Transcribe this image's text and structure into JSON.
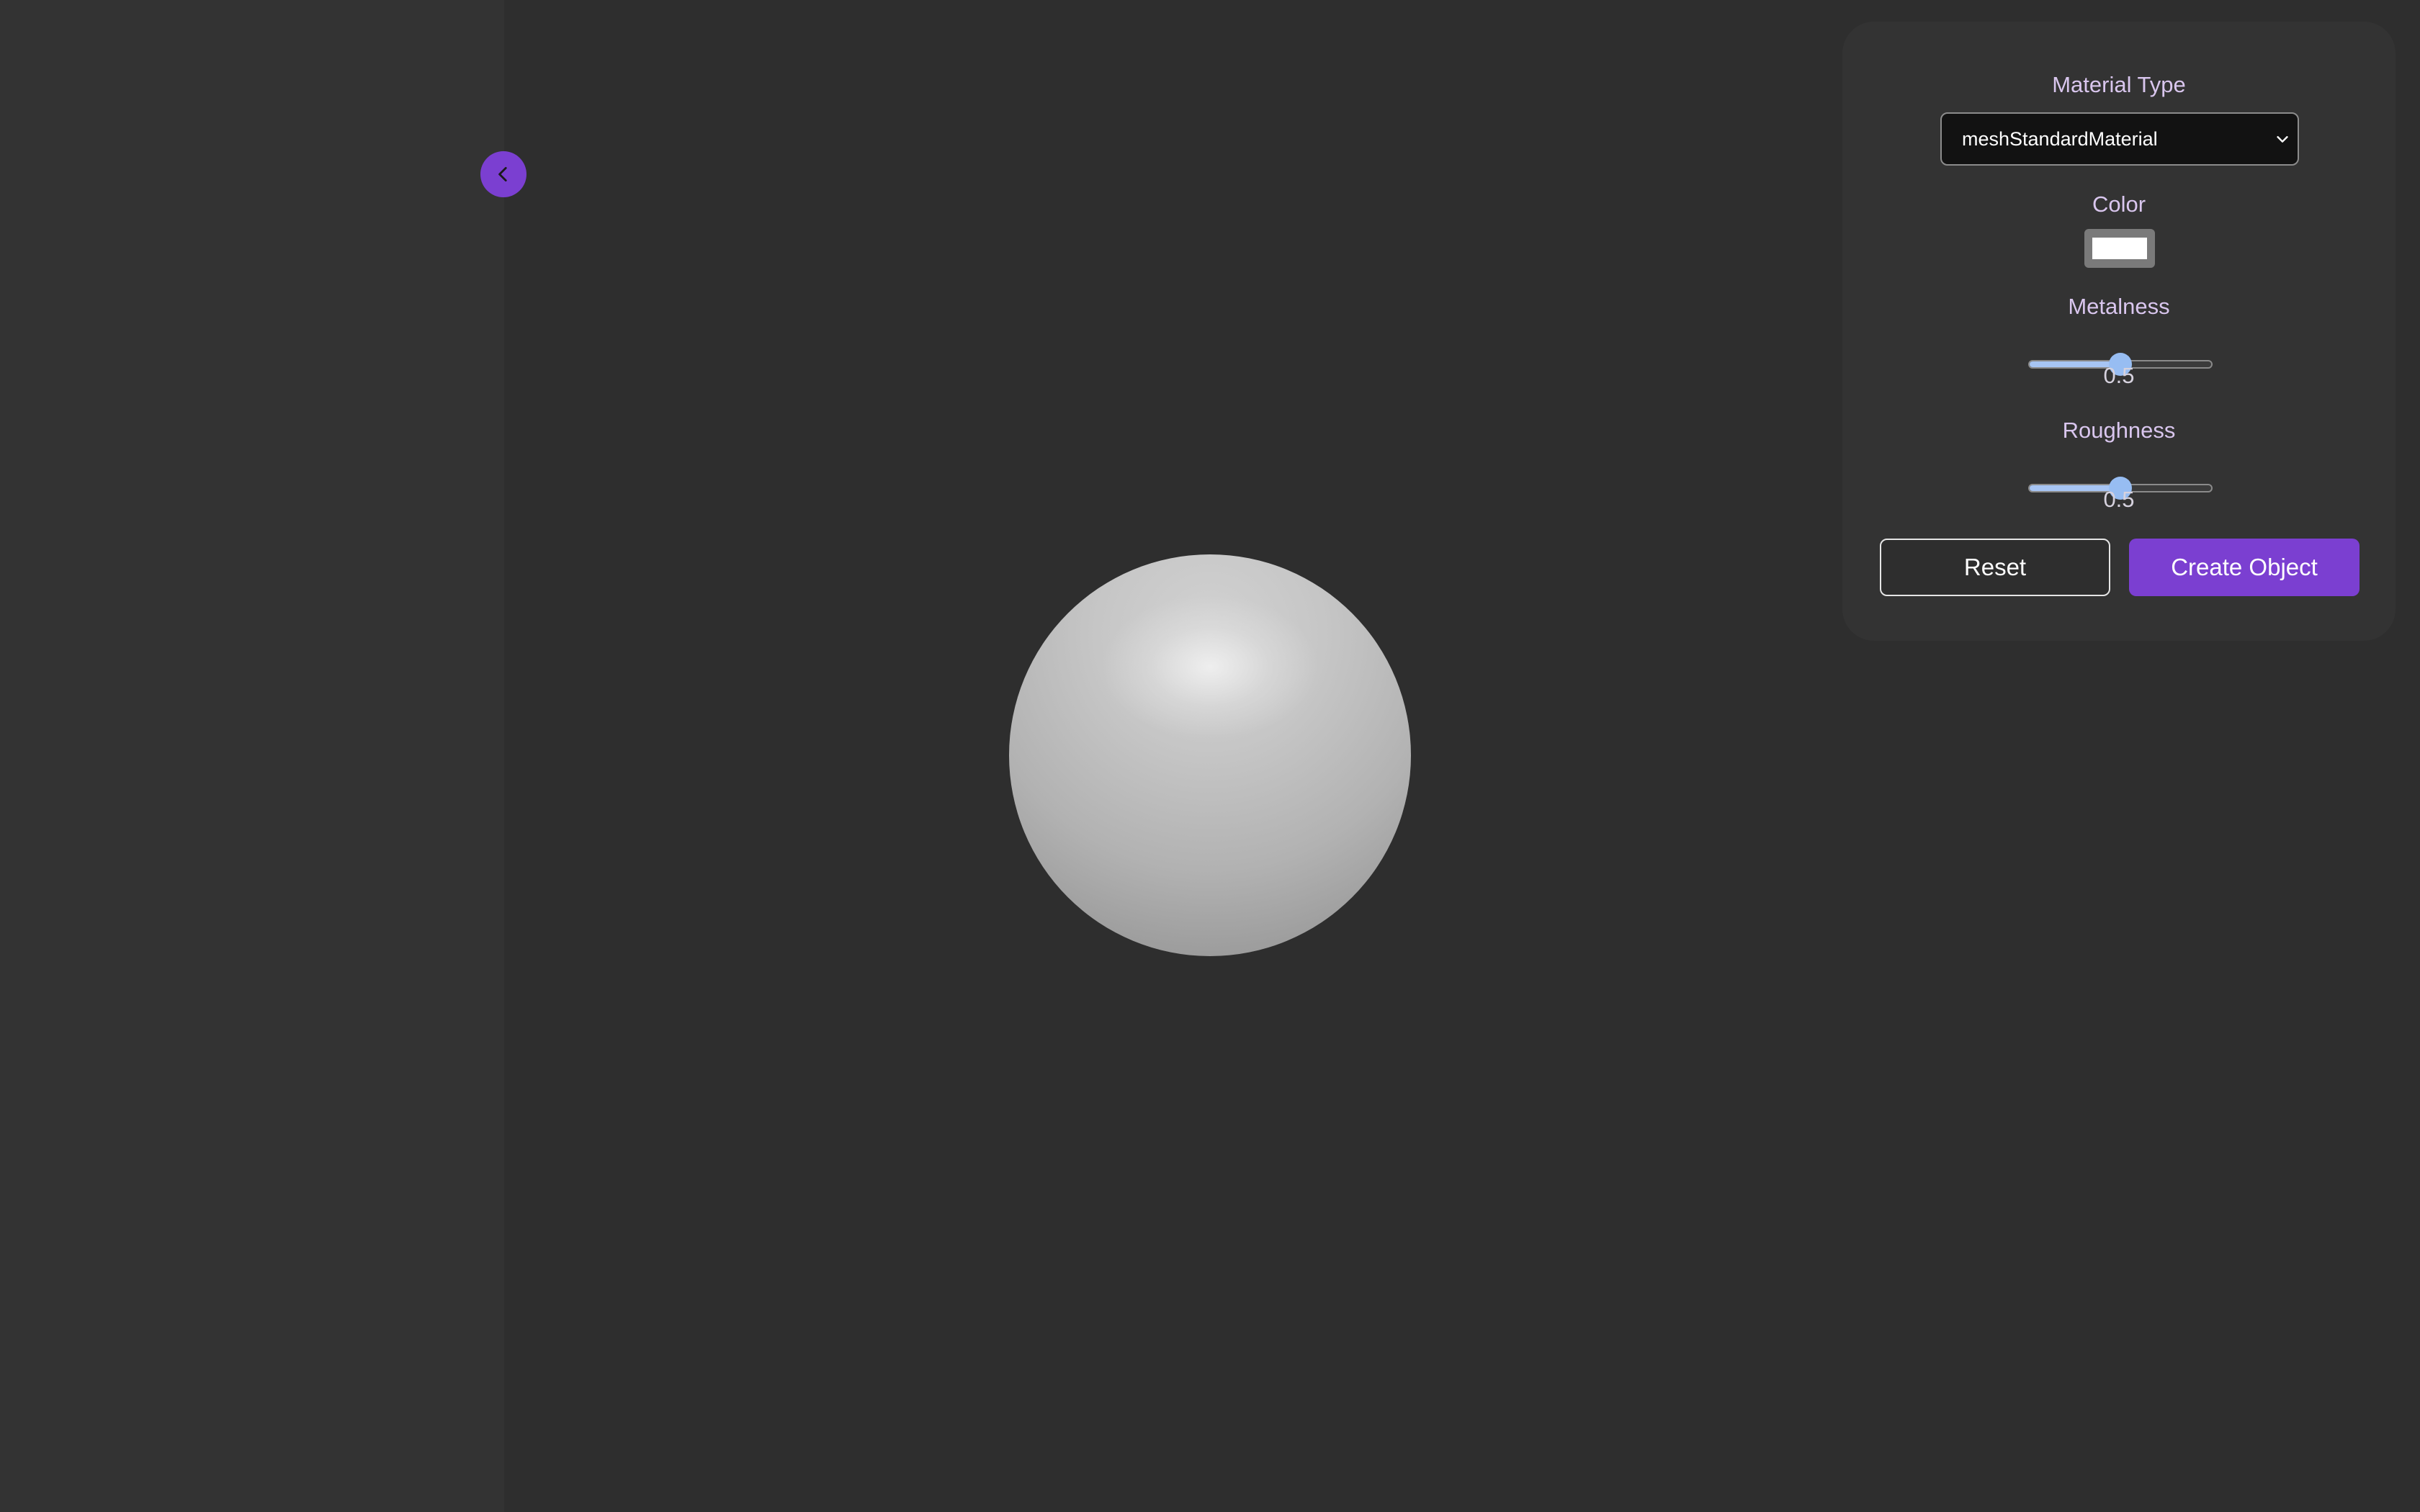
{
  "sidebar": {
    "toggle_icon": "chevron-left-icon"
  },
  "viewport": {
    "object": "sphere",
    "object_color": "#c8c8c8"
  },
  "panel": {
    "material_type": {
      "label": "Material Type",
      "selected": "meshStandardMaterial",
      "icon": "chevron-down-icon"
    },
    "color": {
      "label": "Color",
      "value": "#ffffff"
    },
    "metalness": {
      "label": "Metalness",
      "value": "0.5",
      "fraction": 0.5
    },
    "roughness": {
      "label": "Roughness",
      "value": "0.5",
      "fraction": 0.5
    },
    "reset_label": "Reset",
    "create_label": "Create Object"
  },
  "colors": {
    "accent": "#7b3fd1",
    "slider": "#97bdf2",
    "background": "#2e2e2e",
    "sidebar": "#333333"
  }
}
